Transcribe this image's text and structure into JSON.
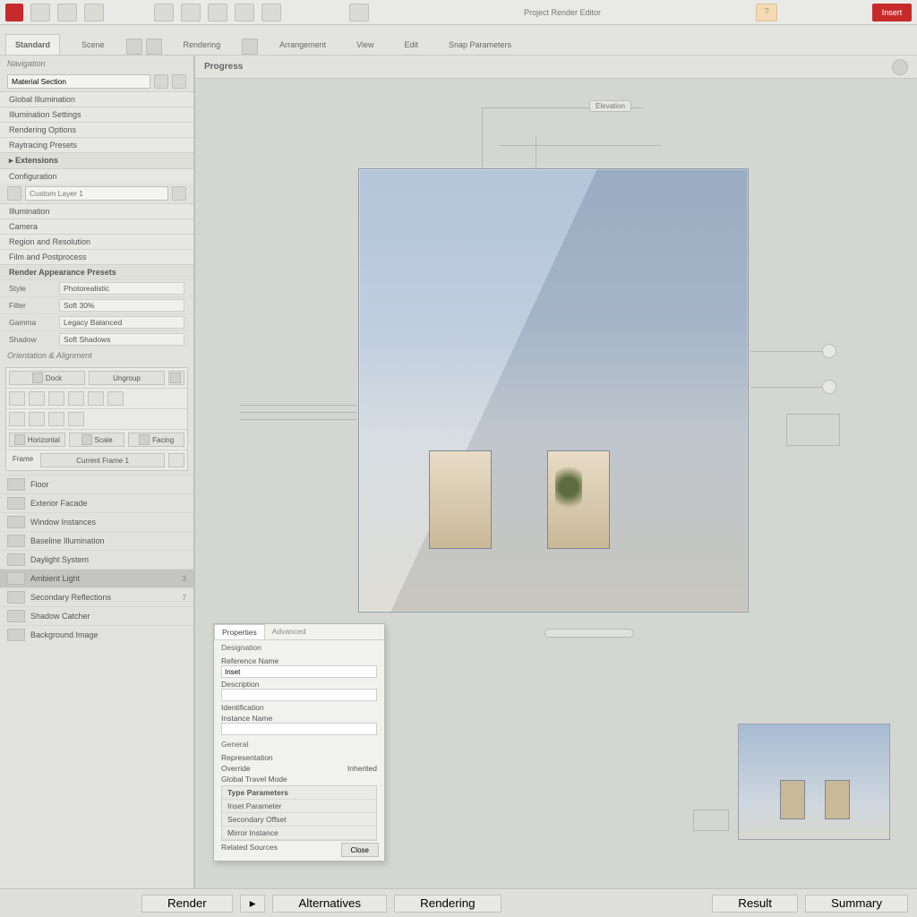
{
  "app": {
    "title": "Project Render Editor"
  },
  "topbar": {
    "help": "?",
    "insert": "Insert"
  },
  "ribbon": {
    "tabs": [
      "Standard",
      "Scene",
      "Rendering",
      "Arrangement",
      "View",
      "Edit",
      "Snap Parameters"
    ],
    "active": 0
  },
  "sidebar": {
    "section1": "Navigation",
    "items1": [
      "Material Section",
      "Global Illumination",
      "Illumination Settings",
      "Rendering Options",
      "Raytracing Presets"
    ],
    "collapse1": "Extensions",
    "section2": "Configuration",
    "input_placeholder": "Custom Layer 1",
    "items2": [
      "Illumination",
      "Camera",
      "Region and Resolution",
      "Film and Postprocess"
    ],
    "header2": "Render Appearance Presets",
    "kv": [
      {
        "k": "Style",
        "v": "Photorealistic"
      },
      {
        "k": "Filter",
        "v": "Soft 30%"
      },
      {
        "k": "Gamma",
        "v": "Legacy Balanced"
      },
      {
        "k": "Shadow",
        "v": "Soft Shadows"
      }
    ],
    "toolhead": "Orientation & Alignment",
    "toolrow1": [
      "Dock",
      "Ungroup"
    ],
    "toolrow2": [
      "Horizontal",
      "Scale",
      "Facing"
    ],
    "toolfoot_k": "Frame",
    "toolfoot_v": "Current Frame 1",
    "objects": [
      {
        "name": "Floor"
      },
      {
        "name": "Exterior Facade"
      },
      {
        "name": "Window Instances"
      },
      {
        "name": "Baseline Illumination"
      },
      {
        "name": "Daylight System"
      },
      {
        "name": "Ambient Light",
        "cnt": "3"
      },
      {
        "name": "Secondary Reflections",
        "cnt": "7"
      },
      {
        "name": "Shadow Catcher"
      },
      {
        "name": "Background Image"
      }
    ],
    "obj_selected": 5
  },
  "canvas": {
    "title": "Progress",
    "annot_top": "Elevation"
  },
  "dialog": {
    "tabs": [
      "Properties",
      "Advanced"
    ],
    "sec1": "Designation",
    "f1_label": "Reference Name",
    "f1_value": "Inset",
    "f2_label": "Description",
    "f3_label": "Identification",
    "f4_label": "Instance Name",
    "sec2": "General",
    "g1": "Representation",
    "g2": "Override",
    "g2_val": "Inherited",
    "g3": "Global Travel Mode",
    "listhead": "Type Parameters",
    "list": [
      "Inset Parameter",
      "Secondary Offset",
      "Mirror Instance"
    ],
    "foot": "Related Sources",
    "btn": "Close"
  },
  "footer": {
    "b1": "Render",
    "b2": "Alternatives",
    "b3": "Rendering",
    "b4": "Result",
    "b5": "Summary"
  }
}
